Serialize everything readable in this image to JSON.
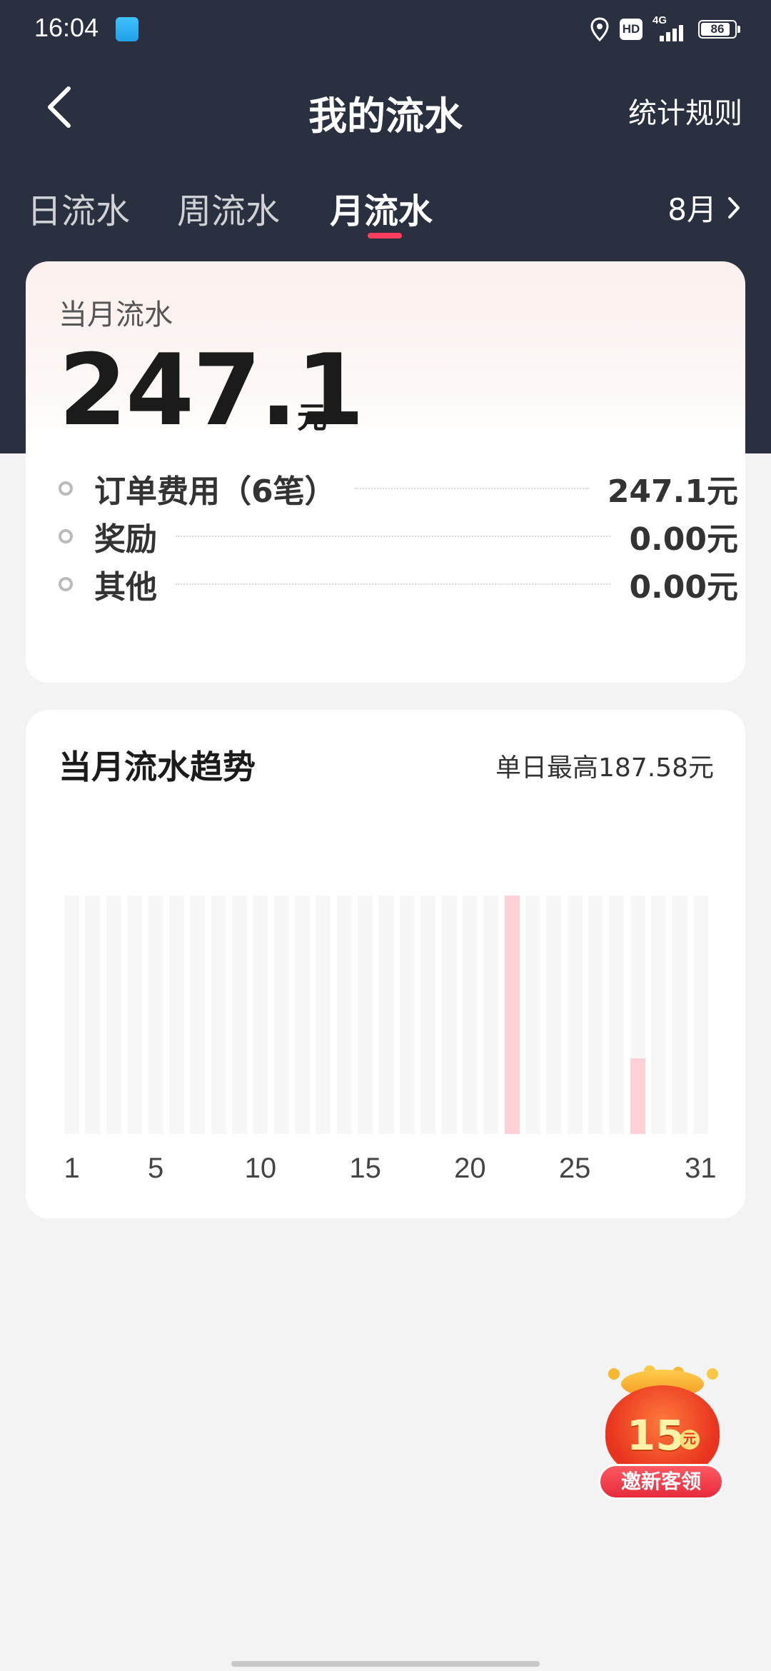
{
  "status_bar": {
    "time": "16:04",
    "network": "4G",
    "hd": "HD",
    "battery": "86"
  },
  "nav": {
    "title": "我的流水",
    "rules_link": "统计规则"
  },
  "tabs": [
    {
      "label": "日流水",
      "active": false
    },
    {
      "label": "周流水",
      "active": false
    },
    {
      "label": "月流水",
      "active": true
    }
  ],
  "month_picker": {
    "label": "8月"
  },
  "summary": {
    "label": "当月流水",
    "amount": "247.1",
    "unit": "元",
    "rows": [
      {
        "label": "订单费用（6笔）",
        "value": "247.1元"
      },
      {
        "label": "奖励",
        "value": "0.00元"
      },
      {
        "label": "其他",
        "value": "0.00元"
      }
    ]
  },
  "trend": {
    "title": "当月流水趋势",
    "max_label": "单日最高187.58元",
    "x_labels": [
      "1",
      "5",
      "10",
      "15",
      "20",
      "25",
      "31"
    ]
  },
  "chart_data": {
    "type": "bar",
    "categories": [
      "1",
      "2",
      "3",
      "4",
      "5",
      "6",
      "7",
      "8",
      "9",
      "10",
      "11",
      "12",
      "13",
      "14",
      "15",
      "16",
      "17",
      "18",
      "19",
      "20",
      "21",
      "22",
      "23",
      "24",
      "25",
      "26",
      "27",
      "28",
      "29",
      "30",
      "31"
    ],
    "values": [
      0,
      0,
      0,
      0,
      0,
      0,
      0,
      0,
      0,
      0,
      0,
      0,
      0,
      0,
      0,
      0,
      0,
      0,
      0,
      0,
      0,
      187.58,
      0,
      0,
      0,
      0,
      0,
      59.52,
      0,
      0,
      0
    ],
    "title": "当月流水趋势",
    "ylim": [
      0,
      187.58
    ],
    "colors": {
      "value_bar": "#ffd0d5",
      "track": "#f7f7f7"
    }
  },
  "promo": {
    "amount": "15",
    "unit": "元",
    "label": "邀新客领"
  },
  "colors": {
    "header_bg": "#2a3040",
    "accent": "#ff3d5c",
    "page_bg": "#f3f3f3"
  }
}
